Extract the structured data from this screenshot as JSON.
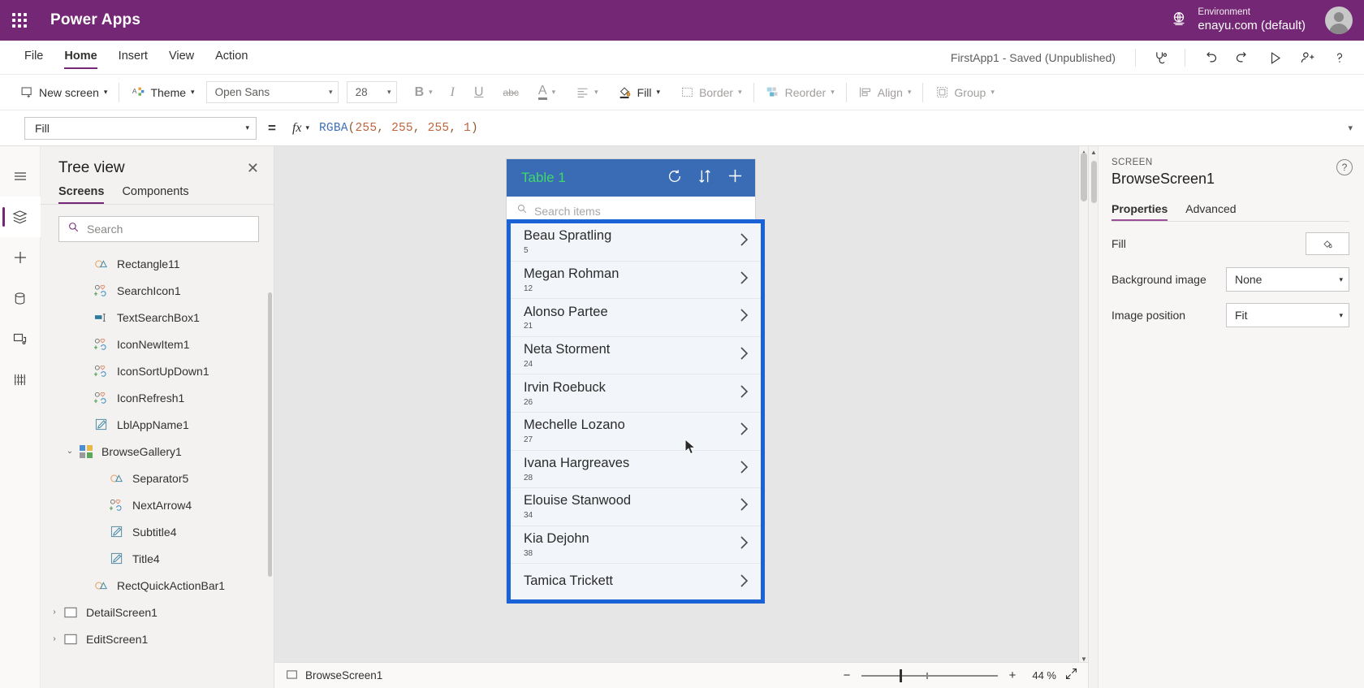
{
  "topbar": {
    "brand": "Power Apps",
    "environment_label": "Environment",
    "environment_value": "enayu.com (default)",
    "waffle_icon": "app-launcher-icon",
    "globe_icon": "globe-icon",
    "avatar_icon": "user-avatar"
  },
  "menubar": {
    "items": [
      {
        "label": "File",
        "active": false
      },
      {
        "label": "Home",
        "active": true
      },
      {
        "label": "Insert",
        "active": false
      },
      {
        "label": "View",
        "active": false
      },
      {
        "label": "Action",
        "active": false
      }
    ],
    "saved_state": "FirstApp1 - Saved (Unpublished)",
    "icons": [
      "app-checker-icon",
      "undo-icon",
      "redo-icon",
      "play-preview-icon",
      "share-icon",
      "help-icon"
    ]
  },
  "ribbon": {
    "new_screen": "New screen",
    "theme": "Theme",
    "font_family": "Open Sans",
    "font_size": "28",
    "bold": "B",
    "italic": "I",
    "underline": "U",
    "strikethrough": "abc",
    "font_color": "A",
    "align": "align-icon",
    "fill": "Fill",
    "border": "Border",
    "reorder": "Reorder",
    "align_group": "Align",
    "group": "Group"
  },
  "formula_bar": {
    "property": "Fill",
    "equals": "=",
    "fx": "fx",
    "formula_fn": "RGBA",
    "formula_args": [
      "255",
      "255",
      "255",
      "1"
    ],
    "formula_full": "RGBA(255, 255, 255, 1)"
  },
  "rail": {
    "items": [
      {
        "name": "hamburger-menu-icon",
        "active": false
      },
      {
        "name": "tree-view-icon",
        "active": true
      },
      {
        "name": "insert-icon",
        "active": false
      },
      {
        "name": "data-icon",
        "active": false
      },
      {
        "name": "media-icon",
        "active": false
      },
      {
        "name": "variables-icon",
        "active": false
      }
    ]
  },
  "tree": {
    "title": "Tree view",
    "close": "✕",
    "tabs": [
      {
        "label": "Screens",
        "active": true
      },
      {
        "label": "Components",
        "active": false
      }
    ],
    "search_placeholder": "Search",
    "nodes": [
      {
        "label": "Rectangle11",
        "indent": 2,
        "icon": "shape-icon",
        "chevron": ""
      },
      {
        "label": "SearchIcon1",
        "indent": 2,
        "icon": "control-icon",
        "chevron": ""
      },
      {
        "label": "TextSearchBox1",
        "indent": 2,
        "icon": "textbox-icon",
        "chevron": ""
      },
      {
        "label": "IconNewItem1",
        "indent": 2,
        "icon": "control-icon",
        "chevron": ""
      },
      {
        "label": "IconSortUpDown1",
        "indent": 2,
        "icon": "control-icon",
        "chevron": ""
      },
      {
        "label": "IconRefresh1",
        "indent": 2,
        "icon": "control-icon",
        "chevron": ""
      },
      {
        "label": "LblAppName1",
        "indent": 2,
        "icon": "label-icon",
        "chevron": ""
      },
      {
        "label": "BrowseGallery1",
        "indent": 1,
        "icon": "gallery-icon",
        "chevron": "⌄"
      },
      {
        "label": "Separator5",
        "indent": 3,
        "icon": "shape-icon",
        "chevron": ""
      },
      {
        "label": "NextArrow4",
        "indent": 3,
        "icon": "control-icon",
        "chevron": ""
      },
      {
        "label": "Subtitle4",
        "indent": 3,
        "icon": "label-icon",
        "chevron": ""
      },
      {
        "label": "Title4",
        "indent": 3,
        "icon": "label-icon",
        "chevron": ""
      },
      {
        "label": "RectQuickActionBar1",
        "indent": 2,
        "icon": "shape-icon",
        "chevron": ""
      },
      {
        "label": "DetailScreen1",
        "indent": 0,
        "icon": "screen-icon",
        "chevron": "›"
      },
      {
        "label": "EditScreen1",
        "indent": 0,
        "icon": "screen-icon",
        "chevron": "›"
      }
    ]
  },
  "app": {
    "title": "Table 1",
    "header_icons": [
      "refresh-icon",
      "sort-icon",
      "add-icon"
    ],
    "search_placeholder": "Search items",
    "gallery_rows": [
      {
        "name": "Beau Spratling",
        "subtitle": "5"
      },
      {
        "name": "Megan Rohman",
        "subtitle": "12"
      },
      {
        "name": "Alonso Partee",
        "subtitle": "21"
      },
      {
        "name": "Neta Storment",
        "subtitle": "24"
      },
      {
        "name": "Irvin Roebuck",
        "subtitle": "26"
      },
      {
        "name": "Mechelle Lozano",
        "subtitle": "27"
      },
      {
        "name": "Ivana Hargreaves",
        "subtitle": "28"
      },
      {
        "name": "Elouise Stanwood",
        "subtitle": "34"
      },
      {
        "name": "Kia Dejohn",
        "subtitle": "38"
      },
      {
        "name": "Tamica Trickett",
        "subtitle": ""
      }
    ],
    "selection_color": "#1a62d6"
  },
  "properties": {
    "kind": "SCREEN",
    "name": "BrowseScreen1",
    "tabs": [
      {
        "label": "Properties",
        "active": true
      },
      {
        "label": "Advanced",
        "active": false
      }
    ],
    "rows": [
      {
        "label": "Fill",
        "type": "swatch",
        "value": ""
      },
      {
        "label": "Background image",
        "type": "select",
        "value": "None"
      },
      {
        "label": "Image position",
        "type": "select",
        "value": "Fit"
      }
    ],
    "help_icon": "help-circle-icon"
  },
  "statusbar": {
    "screen_name": "BrowseScreen1",
    "screen_icon": "screen-icon",
    "zoom_out": "−",
    "zoom_in": "+",
    "zoom_percent": "44 %",
    "fit_icon": "fit-to-screen-icon"
  }
}
